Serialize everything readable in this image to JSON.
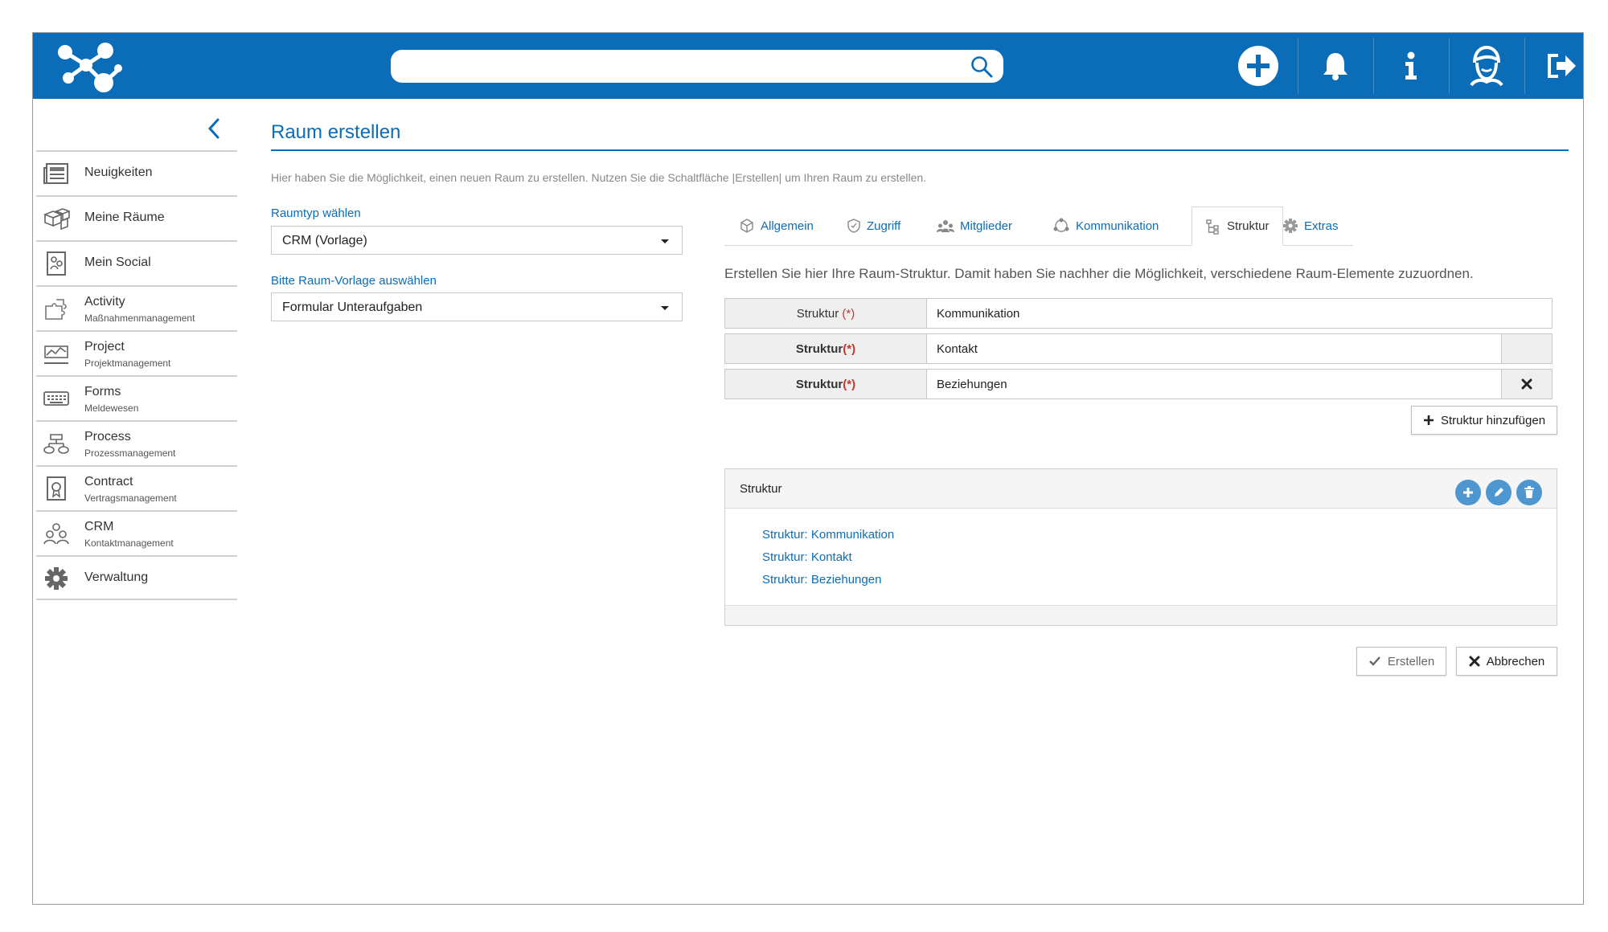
{
  "app": {
    "search_placeholder": "",
    "brand_color": "#0b6db7"
  },
  "topbar": {
    "icons": [
      "network-logo-icon",
      "search-icon",
      "plus-circle-icon",
      "bell-icon",
      "info-icon",
      "avatar-icon",
      "logout-icon"
    ]
  },
  "sidebar": {
    "items": [
      {
        "label": "Neuigkeiten",
        "sub": "",
        "icon": "newspaper-icon"
      },
      {
        "label": "Meine Räume",
        "sub": "",
        "icon": "boxes-icon"
      },
      {
        "label": "Mein Social",
        "sub": "",
        "icon": "social-icon"
      },
      {
        "label": "Activity",
        "sub": "Maßnahmenmanagement",
        "icon": "puzzle-icon"
      },
      {
        "label": "Project",
        "sub": "Projektmanagement",
        "icon": "project-chart-icon"
      },
      {
        "label": "Forms",
        "sub": "Meldewesen",
        "icon": "keyboard-icon"
      },
      {
        "label": "Process",
        "sub": "Prozessmanagement",
        "icon": "process-icon"
      },
      {
        "label": "Contract",
        "sub": "Vertragsmanagement",
        "icon": "contract-icon"
      },
      {
        "label": "CRM",
        "sub": "Kontaktmanagement",
        "icon": "crm-people-icon"
      },
      {
        "label": "Verwaltung",
        "sub": "",
        "icon": "gear-icon"
      }
    ]
  },
  "main": {
    "title": "Raum erstellen",
    "intro": "Hier haben Sie die Möglichkeit, einen neuen Raum zu erstellen. Nutzen Sie die Schaltfläche |Erstellen| um Ihren Raum zu erstellen.",
    "raumtyp_label": "Raumtyp wählen",
    "raumtyp_value": "CRM (Vorlage)",
    "vorlage_label": "Bitte Raum-Vorlage auswählen",
    "vorlage_value": "Formular Unteraufgaben"
  },
  "tabs": [
    {
      "label": "Allgemein",
      "icon": "cube-icon"
    },
    {
      "label": "Zugriff",
      "icon": "shield-icon"
    },
    {
      "label": "Mitglieder",
      "icon": "members-icon"
    },
    {
      "label": "Kommunikation",
      "icon": "chat-icon"
    },
    {
      "label": "Struktur",
      "icon": "tree-icon",
      "active": true
    },
    {
      "label": "Extras",
      "icon": "gear-icon"
    }
  ],
  "struktur": {
    "intro": "Erstellen Sie hier Ihre Raum-Struktur. Damit haben Sie nachher die Möglichkeit, verschiedene Raum-Elemente zuzuordnen.",
    "rows": [
      {
        "label": "Struktur",
        "req": "(*)",
        "value": "Kommunikation"
      },
      {
        "label": "Struktur",
        "req": "(*)",
        "value": "Kontakt"
      },
      {
        "label": "Struktur",
        "req": "(*)",
        "value": "Beziehungen"
      }
    ],
    "add_button": "Struktur hinzufügen",
    "panel_title": "Struktur",
    "tree": [
      "Struktur: Kommunikation",
      "Struktur: Kontakt",
      "Struktur: Beziehungen"
    ]
  },
  "actions": {
    "create": "Erstellen",
    "cancel": "Abbrechen"
  }
}
